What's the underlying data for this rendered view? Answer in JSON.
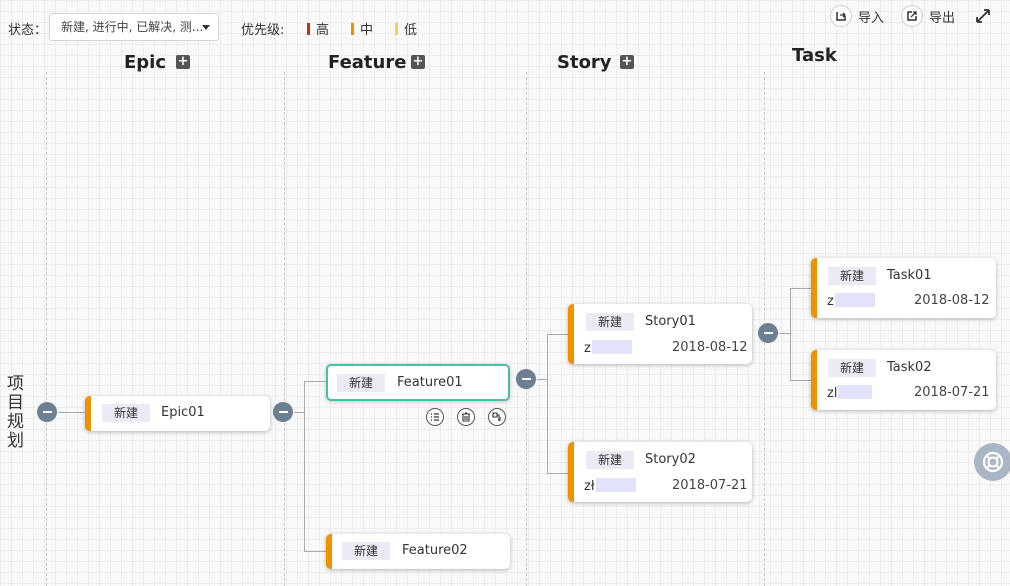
{
  "toolbar": {
    "status_label": "状态：",
    "status_value": "新建, 进行中, 已解决, 测...",
    "priority_label": "优先级:",
    "priorities": [
      {
        "label": "高",
        "color": "#b23a1a"
      },
      {
        "label": "中",
        "color": "#f29100"
      },
      {
        "label": "低",
        "color": "#f7d25a"
      }
    ],
    "import_label": "导入",
    "export_label": "导出"
  },
  "columns": [
    "Epic",
    "Feature",
    "Story",
    "Task"
  ],
  "root_label": "项目规划",
  "accent_color": "#f29100",
  "selected_color": "#4bbfa3",
  "cards": {
    "epic01": {
      "status": "新建",
      "name": "Epic01"
    },
    "feature01": {
      "status": "新建",
      "name": "Feature01"
    },
    "feature02": {
      "status": "新建",
      "name": "Feature02"
    },
    "story01": {
      "status": "新建",
      "name": "Story01",
      "user": "z",
      "date": "2018-08-12"
    },
    "story02": {
      "status": "新建",
      "name": "Story02",
      "user": "zł",
      "date": "2018-07-21"
    },
    "task01": {
      "status": "新建",
      "name": "Task01",
      "user": "z",
      "date": "2018-08-12"
    },
    "task02": {
      "status": "新建",
      "name": "Task02",
      "user": "zl",
      "date": "2018-07-21"
    }
  },
  "icons": {
    "import": "import-icon",
    "export": "export-icon",
    "fullscreen": "fullscreen-icon",
    "list": "list-icon",
    "delete": "trash-icon",
    "add_child": "add-child-icon",
    "help": "help-icon"
  }
}
